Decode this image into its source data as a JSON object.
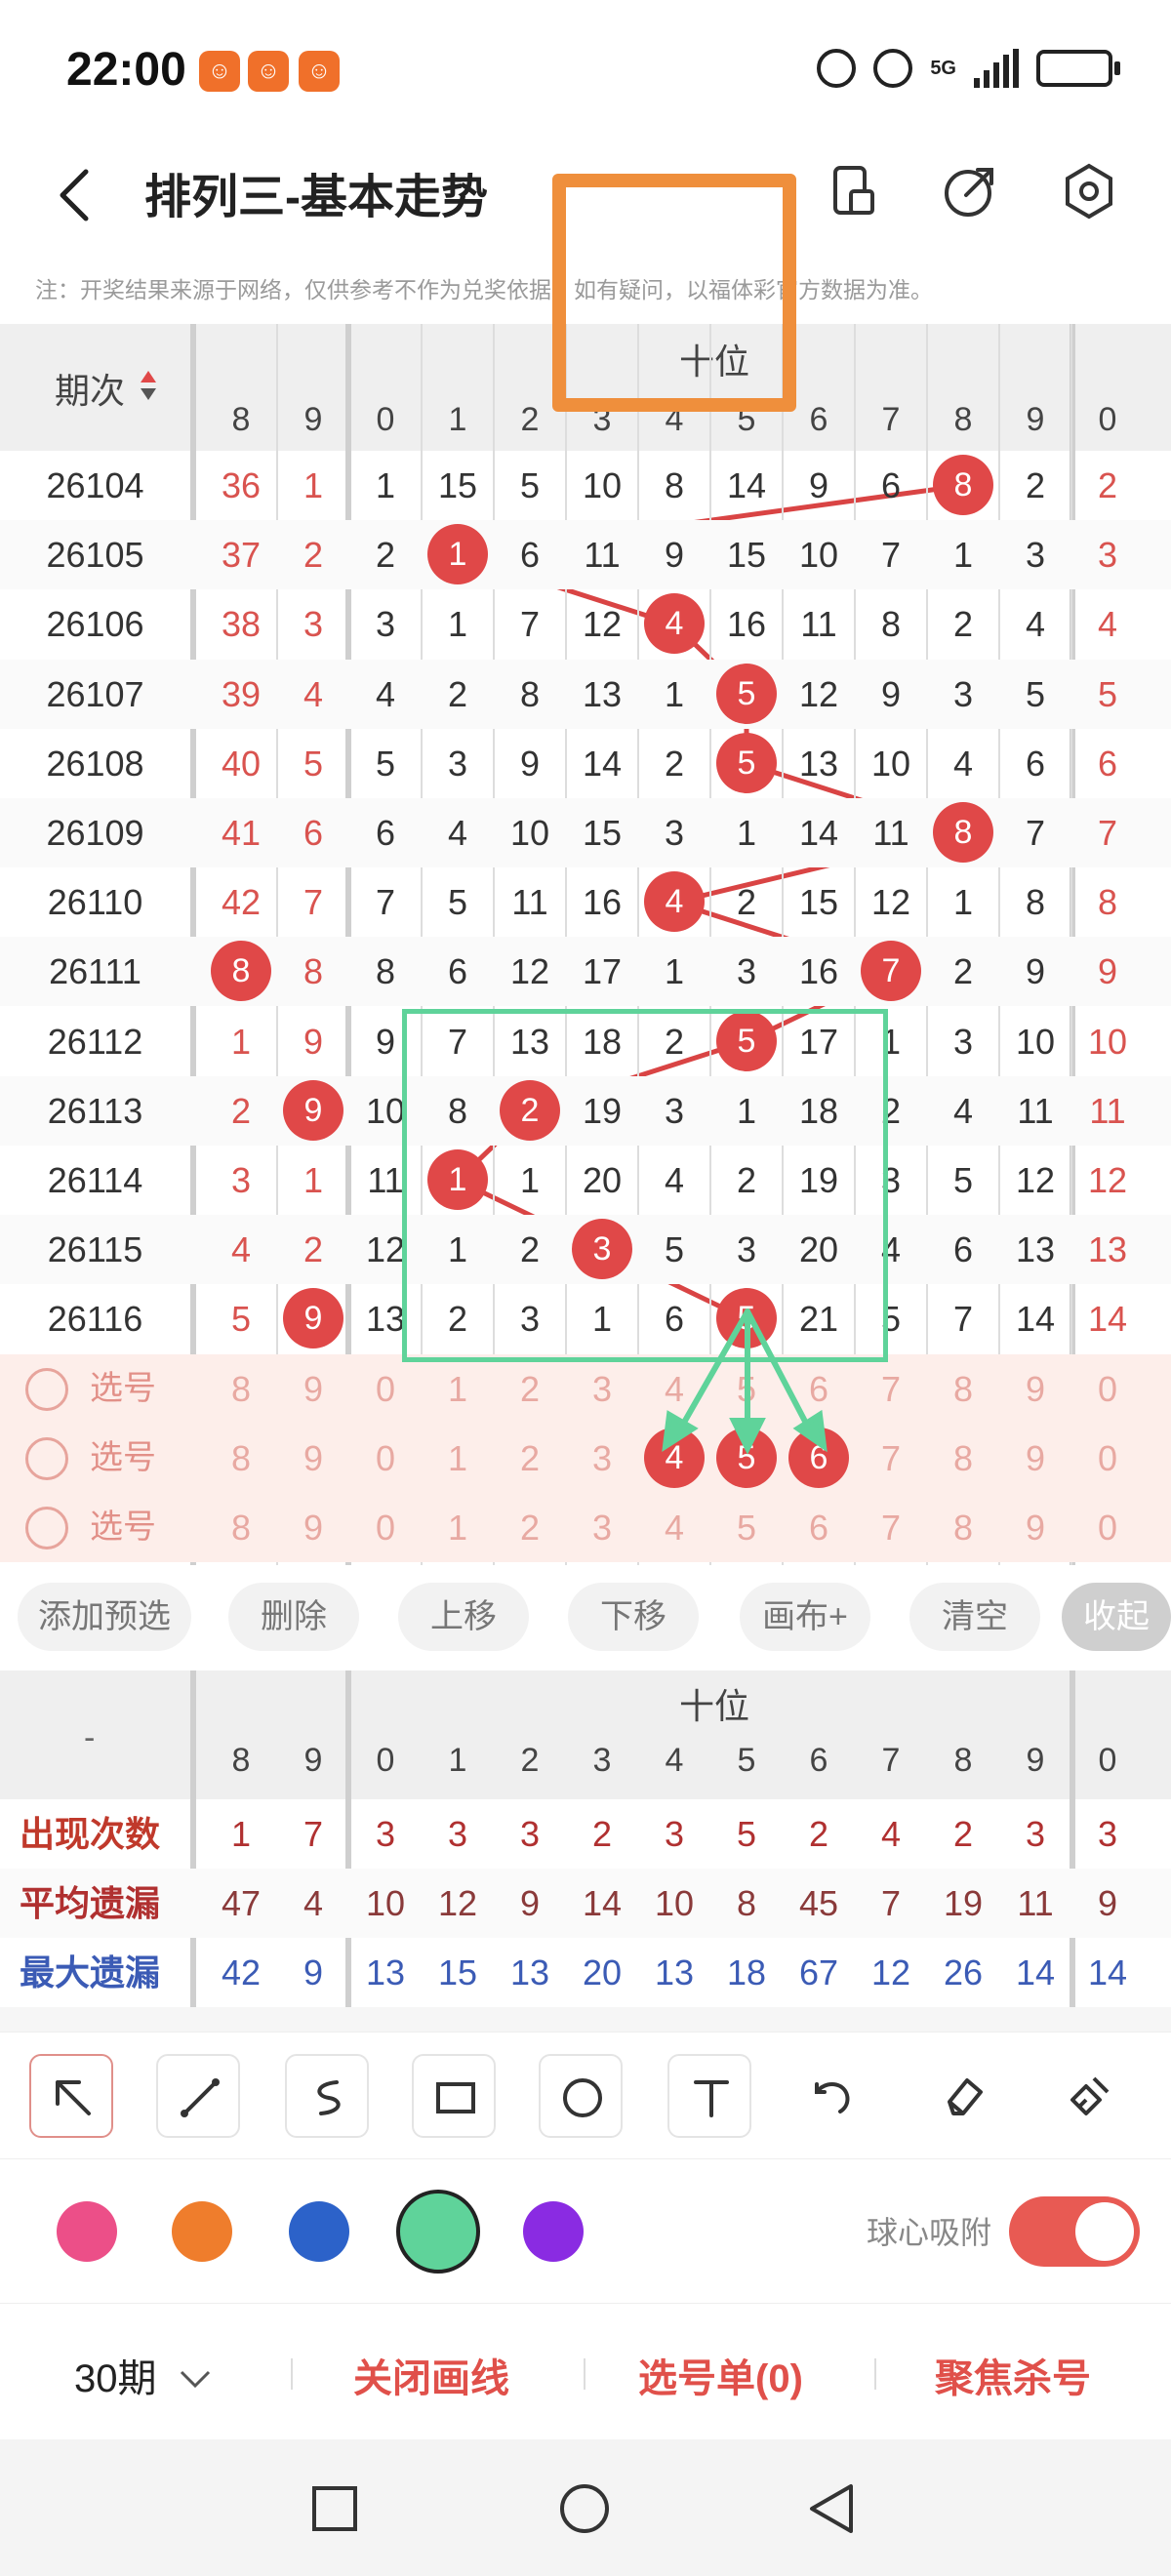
{
  "status_bar": {
    "time": "22:00",
    "network": "5G",
    "signal_label": "1"
  },
  "header": {
    "title": "排列三-基本走势"
  },
  "note": "注：开奖结果来源于网络，仅供参考不作为兑奖依据。如有疑问，以福体彩官方数据为准。",
  "grid": {
    "period_label": "期次",
    "position_label": "十位",
    "column_headers": [
      "8",
      "9",
      "0",
      "1",
      "2",
      "3",
      "4",
      "5",
      "6",
      "7",
      "8",
      "9",
      "0"
    ],
    "rows": [
      {
        "period": "26104",
        "cells": [
          "36",
          "1",
          "1",
          "15",
          "5",
          "10",
          "8",
          "14",
          "9",
          "6",
          "8",
          "2",
          "2"
        ],
        "ball": 10
      },
      {
        "period": "26105",
        "cells": [
          "37",
          "2",
          "2",
          "1",
          "6",
          "11",
          "9",
          "15",
          "10",
          "7",
          "1",
          "3",
          "3"
        ],
        "ball": 3
      },
      {
        "period": "26106",
        "cells": [
          "38",
          "3",
          "3",
          "1",
          "7",
          "12",
          "4",
          "16",
          "11",
          "8",
          "2",
          "4",
          "4"
        ],
        "ball": 6
      },
      {
        "period": "26107",
        "cells": [
          "39",
          "4",
          "4",
          "2",
          "8",
          "13",
          "1",
          "5",
          "12",
          "9",
          "3",
          "5",
          "5"
        ],
        "ball": 7
      },
      {
        "period": "26108",
        "cells": [
          "40",
          "5",
          "5",
          "3",
          "9",
          "14",
          "2",
          "5",
          "13",
          "10",
          "4",
          "6",
          "6"
        ],
        "ball": 7
      },
      {
        "period": "26109",
        "cells": [
          "41",
          "6",
          "6",
          "4",
          "10",
          "15",
          "3",
          "1",
          "14",
          "11",
          "8",
          "7",
          "7"
        ],
        "ball": 10
      },
      {
        "period": "26110",
        "cells": [
          "42",
          "7",
          "7",
          "5",
          "11",
          "16",
          "4",
          "2",
          "15",
          "12",
          "1",
          "8",
          "8"
        ],
        "ball": 6
      },
      {
        "period": "26111",
        "cells": [
          "8",
          "8",
          "8",
          "6",
          "12",
          "17",
          "1",
          "3",
          "16",
          "7",
          "2",
          "9",
          "9"
        ],
        "ball": 9
      },
      {
        "period": "26112",
        "cells": [
          "1",
          "9",
          "9",
          "7",
          "13",
          "18",
          "2",
          "5",
          "17",
          "1",
          "3",
          "10",
          "10"
        ],
        "ball": 7
      },
      {
        "period": "26113",
        "cells": [
          "2",
          "9",
          "10",
          "8",
          "2",
          "19",
          "3",
          "1",
          "18",
          "2",
          "4",
          "11",
          "11"
        ],
        "ball": 4
      },
      {
        "period": "26114",
        "cells": [
          "3",
          "1",
          "11",
          "1",
          "1",
          "20",
          "4",
          "2",
          "19",
          "3",
          "5",
          "12",
          "12"
        ],
        "ball": 3
      },
      {
        "period": "26115",
        "cells": [
          "4",
          "2",
          "12",
          "1",
          "2",
          "3",
          "5",
          "3",
          "20",
          "4",
          "6",
          "13",
          "13"
        ],
        "ball": 5
      },
      {
        "period": "26116",
        "cells": [
          "5",
          "9",
          "13",
          "2",
          "3",
          "1",
          "6",
          "5",
          "21",
          "5",
          "7",
          "14",
          "14"
        ],
        "ball": 7
      }
    ],
    "left_balls": [
      {
        "row": 7,
        "value": "8"
      },
      {
        "row": 9,
        "value": "9"
      },
      {
        "row": 12,
        "value": "9"
      }
    ],
    "selection_rows": [
      {
        "label": "选号",
        "cells": [
          "8",
          "9",
          "0",
          "1",
          "2",
          "3",
          "4",
          "5",
          "6",
          "7",
          "8",
          "9",
          "0"
        ]
      },
      {
        "label": "选号",
        "cells": [
          "8",
          "9",
          "0",
          "1",
          "2",
          "3",
          "4",
          "5",
          "6",
          "7",
          "8",
          "9",
          "0"
        ]
      },
      {
        "label": "选号",
        "cells": [
          "8",
          "9",
          "0",
          "1",
          "2",
          "3",
          "4",
          "5",
          "6",
          "7",
          "8",
          "9",
          "0"
        ]
      }
    ],
    "predicted_balls": [
      "4",
      "5",
      "6"
    ]
  },
  "actions": [
    "添加预选",
    "删除",
    "上移",
    "下移",
    "画布+",
    "清空",
    "收起"
  ],
  "stats": {
    "corner": "-",
    "position_label": "十位",
    "column_headers": [
      "8",
      "9",
      "0",
      "1",
      "2",
      "3",
      "4",
      "5",
      "6",
      "7",
      "8",
      "9",
      "0"
    ],
    "rows": [
      {
        "label": "出现次数",
        "color": "#c0392b",
        "cells": [
          "1",
          "7",
          "3",
          "3",
          "3",
          "2",
          "3",
          "5",
          "2",
          "4",
          "2",
          "3",
          "3"
        ],
        "cell_color": "#b03030"
      },
      {
        "label": "平均遗漏",
        "color": "#b03030",
        "cells": [
          "47",
          "4",
          "10",
          "12",
          "9",
          "14",
          "10",
          "8",
          "45",
          "7",
          "19",
          "11",
          "9"
        ],
        "cell_color": "#8a3a3a"
      },
      {
        "label": "最大遗漏",
        "color": "#3b5bb5",
        "cells": [
          "42",
          "9",
          "13",
          "15",
          "13",
          "20",
          "13",
          "18",
          "67",
          "12",
          "26",
          "14",
          "14"
        ],
        "cell_color": "#3b5bb5"
      }
    ]
  },
  "toolbar": {
    "tools": [
      "arrow-icon",
      "line-icon",
      "curve-icon",
      "rectangle-icon",
      "circle-icon",
      "text-icon",
      "undo-icon",
      "eraser-icon",
      "brush-clear-icon"
    ]
  },
  "colors": {
    "swatches": [
      "#ec4f88",
      "#ef7d2c",
      "#2c62c9",
      "#5fd39a",
      "#8a2be2"
    ],
    "selected": "#5fd39a",
    "magnet_label": "球心吸附"
  },
  "bottom_bar": {
    "period_select": "30期",
    "close_lines": "关闭画线",
    "selection_list": "选号单(0)",
    "focus_kill": "聚焦杀号"
  }
}
